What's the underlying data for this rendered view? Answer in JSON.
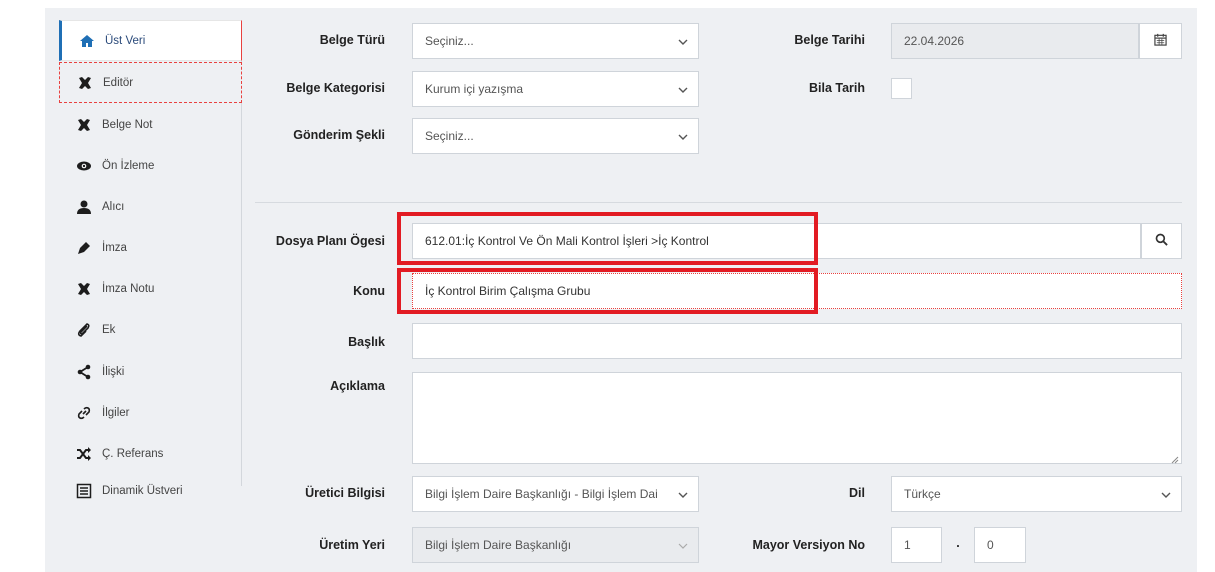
{
  "sidebar": {
    "items": [
      {
        "label": "Üst Veri",
        "icon": "home-icon"
      },
      {
        "label": "Editör",
        "icon": "tools-icon"
      },
      {
        "label": "Belge Not",
        "icon": "tools-icon"
      },
      {
        "label": "Ön İzleme",
        "icon": "eye-icon"
      },
      {
        "label": "Alıcı",
        "icon": "user-icon"
      },
      {
        "label": "İmza",
        "icon": "pen-icon"
      },
      {
        "label": "İmza Notu",
        "icon": "tools-icon"
      },
      {
        "label": "Ek",
        "icon": "paperclip-icon"
      },
      {
        "label": "İlişki",
        "icon": "share-icon"
      },
      {
        "label": "İlgiler",
        "icon": "link-icon"
      },
      {
        "label": "Ç. Referans",
        "icon": "random-icon"
      },
      {
        "label": "Dinamik Üstveri",
        "icon": "list-icon"
      }
    ]
  },
  "form": {
    "belge_turu": {
      "label": "Belge Türü",
      "value": "Seçiniz..."
    },
    "belge_kategorisi": {
      "label": "Belge Kategorisi",
      "value": "Kurum içi yazışma"
    },
    "gonderim_sekli": {
      "label": "Gönderim Şekli",
      "value": "Seçiniz..."
    },
    "belge_tarihi": {
      "label": "Belge Tarihi",
      "value": "22.04.2026"
    },
    "bila_tarih": {
      "label": "Bila Tarih",
      "checked": false
    },
    "dosya_plani": {
      "label": "Dosya Planı Ögesi",
      "value": "612.01:İç Kontrol Ve Ön Mali Kontrol İşleri >İç Kontrol"
    },
    "konu": {
      "label": "Konu",
      "value": "İç Kontrol Birim Çalışma Grubu"
    },
    "baslik": {
      "label": "Başlık",
      "value": ""
    },
    "aciklama": {
      "label": "Açıklama",
      "value": ""
    },
    "uretici_bilgisi": {
      "label": "Üretici Bilgisi",
      "value": "Bilgi İşlem Daire Başkanlığı - Bilgi İşlem Dai"
    },
    "dil": {
      "label": "Dil",
      "value": "Türkçe"
    },
    "uretim_yeri": {
      "label": "Üretim Yeri",
      "value": "Bilgi İşlem Daire Başkanlığı"
    },
    "mayor_versiyon": {
      "label": "Mayor Versiyon No",
      "major": "1",
      "separator": ".",
      "minor": "0"
    }
  },
  "colors": {
    "accent": "#1f6fb5",
    "highlight": "#e21b23",
    "background": "#eef0f3"
  }
}
